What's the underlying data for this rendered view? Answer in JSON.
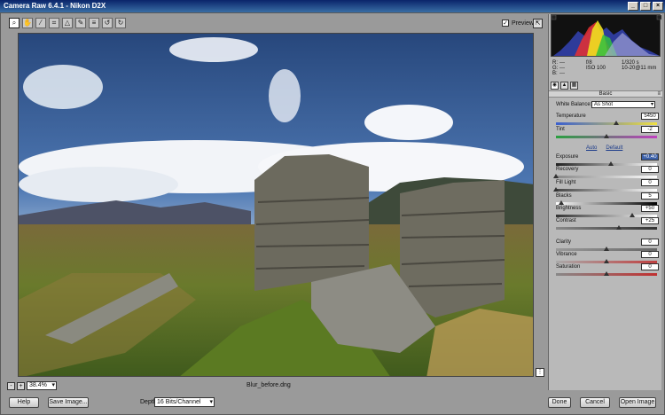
{
  "window": {
    "title": "Camera Raw 6.4.1  -  Nikon D2X",
    "minimize": "_",
    "maximize": "□",
    "close": "×"
  },
  "toolbar": {
    "tools": [
      "zoom-icon",
      "hand-icon",
      "eyedropper-icon",
      "crop-icon",
      "straighten-icon",
      "retouch-icon",
      "list-icon",
      "rotate-left-icon",
      "rotate-right-icon"
    ]
  },
  "preview": {
    "label": "Preview",
    "checked": "✓"
  },
  "status": {
    "zoom": "38.4%",
    "minus": "-",
    "plus": "+",
    "filename": "Blur_before.dng"
  },
  "histogram_info": {
    "r": "R:",
    "g": "G:",
    "b": "B:",
    "r_val": "---",
    "g_val": "---",
    "b_val": "---",
    "aperture": "f/8",
    "shutter": "1/320 s",
    "iso": "ISO 100",
    "lens": "10-20@11 mm"
  },
  "panel": {
    "title": "Basic",
    "menu": "≡"
  },
  "white_balance": {
    "label": "White Balance:",
    "value": "As Shot"
  },
  "sliders": [
    {
      "label": "Temperature",
      "value": "5450",
      "pos": 0.6
    },
    {
      "label": "Tint",
      "value": "-2",
      "pos": 0.5
    },
    {
      "label": "Exposure",
      "value": "+0.40",
      "pos": 0.54,
      "selected": true
    },
    {
      "label": "Recovery",
      "value": "0",
      "pos": 0.0
    },
    {
      "label": "Fill Light",
      "value": "0",
      "pos": 0.0
    },
    {
      "label": "Blacks",
      "value": "5",
      "pos": 0.05
    },
    {
      "label": "Brightness",
      "value": "+50",
      "pos": 0.75
    },
    {
      "label": "Contrast",
      "value": "+25",
      "pos": 0.62
    },
    {
      "label": "Clarity",
      "value": "0",
      "pos": 0.5
    },
    {
      "label": "Vibrance",
      "value": "0",
      "pos": 0.5
    },
    {
      "label": "Saturation",
      "value": "0",
      "pos": 0.5
    }
  ],
  "links": {
    "auto": "Auto",
    "default": "Default"
  },
  "bottom": {
    "help": "Help",
    "save": "Save Image...",
    "depth_label": "Depth:",
    "depth": "16 Bits/Channel",
    "done": "Done",
    "cancel": "Cancel",
    "open": "Open Image"
  }
}
